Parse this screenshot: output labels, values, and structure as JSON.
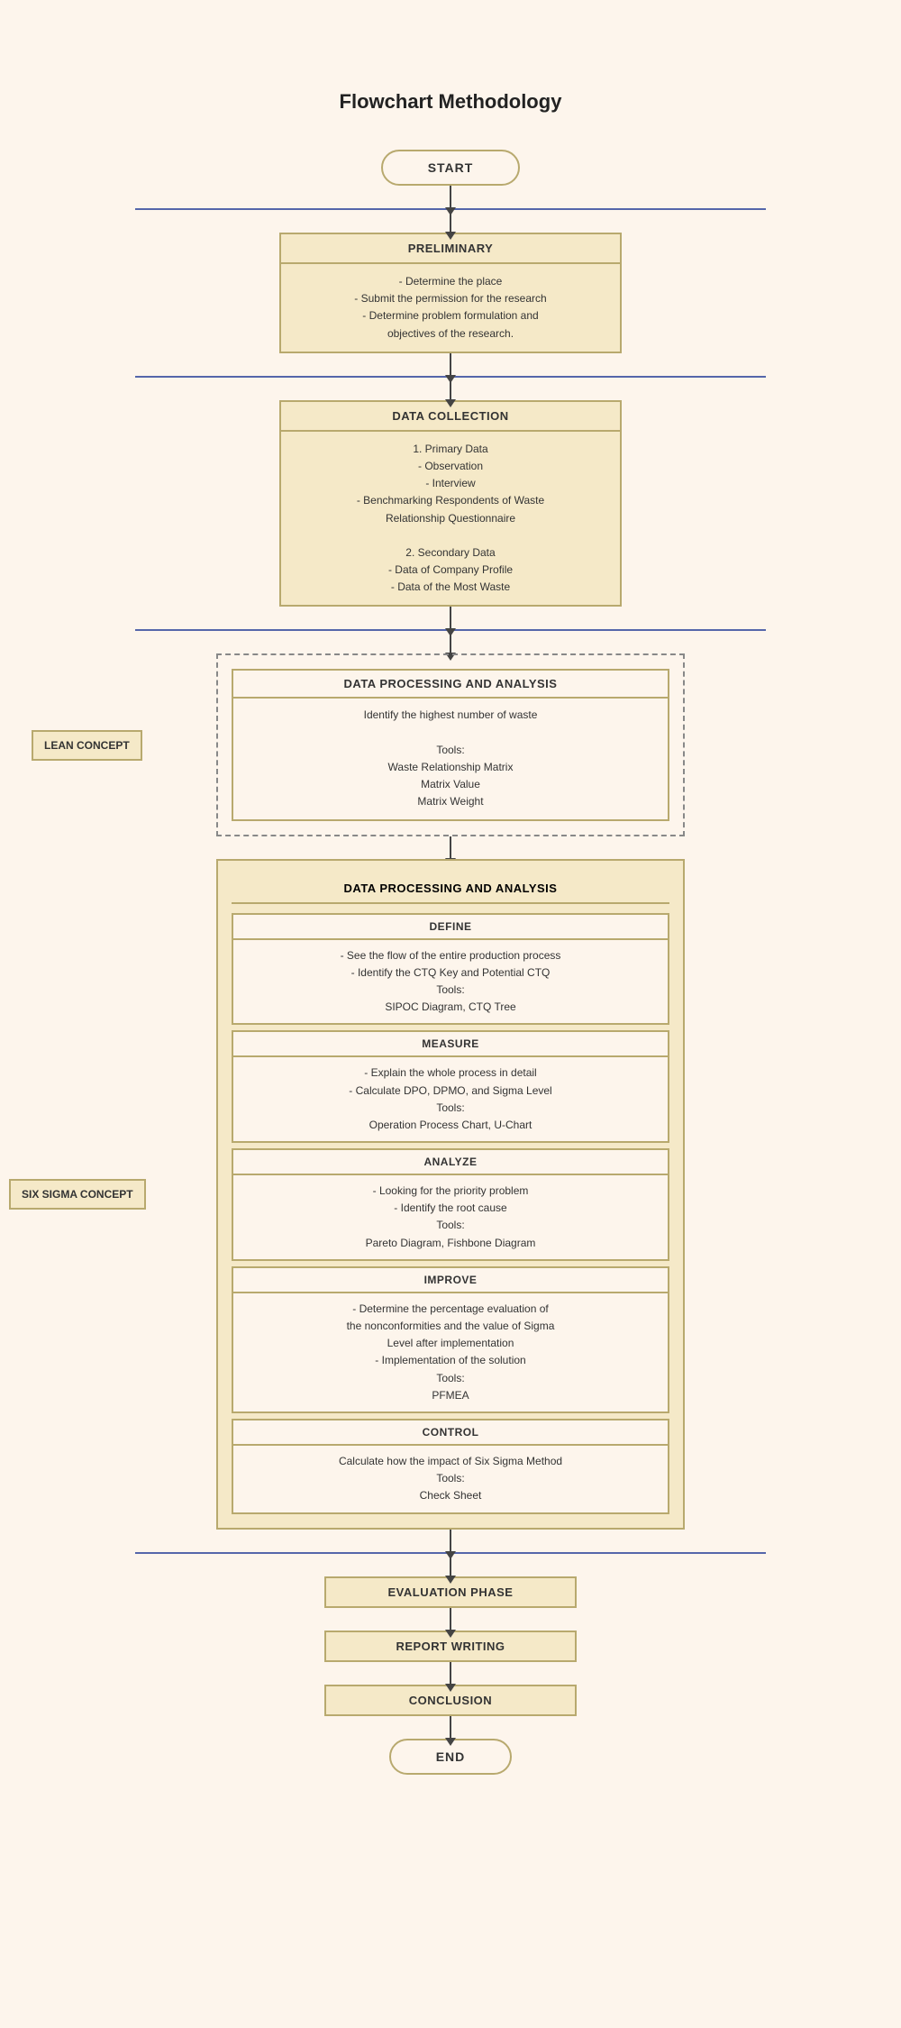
{
  "title": "Flowchart Methodology",
  "start": "START",
  "end": "END",
  "preliminary": {
    "header": "PRELIMINARY",
    "body": "- Determine the place\n- Submit the permission for the research\n- Determine problem formulation and\nobjectives of the research."
  },
  "dataCollection": {
    "header": "DATA COLLECTION",
    "body": "1. Primary Data\n- Observation\n- Interview\n- Benchmarking Respondents of Waste\nRelationship Questionnaire\n\n2. Secondary Data\n- Data of Company Profile\n- Data of the Most Waste"
  },
  "leanConcept": {
    "label": "LEAN CONCEPT",
    "innerHeader": "DATA PROCESSING AND ANALYSIS",
    "innerBody": "Identify the highest number of waste\n\nTools:\nWaste Relationship Matrix\nMatrix Value\nMatrix Weight"
  },
  "sixSigmaConcept": {
    "label": "SIX SIGMA CONCEPT",
    "outerHeader": "DATA PROCESSING AND ANALYSIS",
    "sections": [
      {
        "header": "DEFINE",
        "body": "- See the flow of the entire production process\n- Identify the CTQ Key and Potential CTQ\nTools:\nSIPOC Diagram, CTQ Tree"
      },
      {
        "header": "MEASURE",
        "body": "- Explain the whole process in detail\n- Calculate DPO, DPMO, and Sigma Level\nTools:\nOperation Process Chart, U-Chart"
      },
      {
        "header": "ANALYZE",
        "body": "- Looking for the priority problem\n- Identify the root cause\nTools:\nPareto Diagram, Fishbone Diagram"
      },
      {
        "header": "IMPROVE",
        "body": "- Determine the percentage evaluation of\nthe nonconformities and the value of Sigma\nLevel after implementation\n- Implementation of the solution\nTools:\nPFMEA"
      },
      {
        "header": "CONTROL",
        "body": "Calculate how the impact of Six Sigma Method\nTools:\nCheck Sheet"
      }
    ]
  },
  "evaluationPhase": "EVALUATION PHASE",
  "reportWriting": "REPORT WRITING",
  "conclusion": "CONCLUSION"
}
